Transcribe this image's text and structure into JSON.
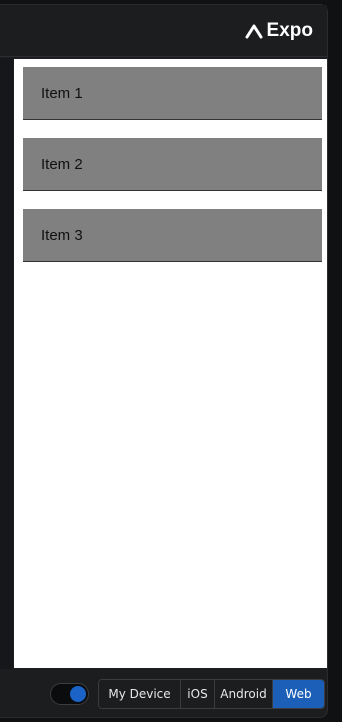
{
  "header": {
    "brand_label": "Expo"
  },
  "list": {
    "items": [
      {
        "label": "Item 1"
      },
      {
        "label": "Item 2"
      },
      {
        "label": "Item 3"
      }
    ]
  },
  "footer": {
    "toggle_state": "on",
    "platforms": [
      {
        "label": "My Device",
        "active": false
      },
      {
        "label": "iOS",
        "active": false
      },
      {
        "label": "Android",
        "active": false
      },
      {
        "label": "Web",
        "active": true
      }
    ]
  },
  "colors": {
    "accent": "#1b5fb8",
    "item_bg": "#808080",
    "chrome_bg": "#1c1d1f"
  }
}
